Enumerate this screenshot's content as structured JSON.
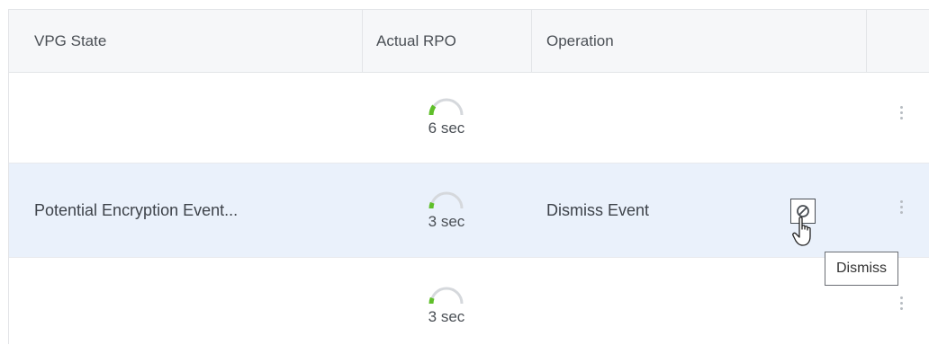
{
  "columns": {
    "vpg_state": "VPG State",
    "actual_rpo": "Actual RPO",
    "operation": "Operation"
  },
  "rows": [
    {
      "vpg_state": "",
      "rpo_value": 6,
      "rpo_label": "6 sec",
      "operation": ""
    },
    {
      "vpg_state": "Potential Encryption Event...",
      "rpo_value": 3,
      "rpo_label": "3 sec",
      "operation": "Dismiss Event",
      "selected": true
    },
    {
      "vpg_state": "",
      "rpo_value": 3,
      "rpo_label": "3 sec",
      "operation": ""
    }
  ],
  "tooltip": "Dismiss",
  "icons": {
    "dismiss": "ban-icon",
    "row_menu": "kebab-menu-icon",
    "rpo_gauge": "rpo-gauge-icon",
    "cursor": "hand-pointer-icon"
  },
  "colors": {
    "gauge_fill": "#5fbf2a",
    "gauge_track": "#d5d8dc",
    "selected_row": "#eaf1fb"
  }
}
